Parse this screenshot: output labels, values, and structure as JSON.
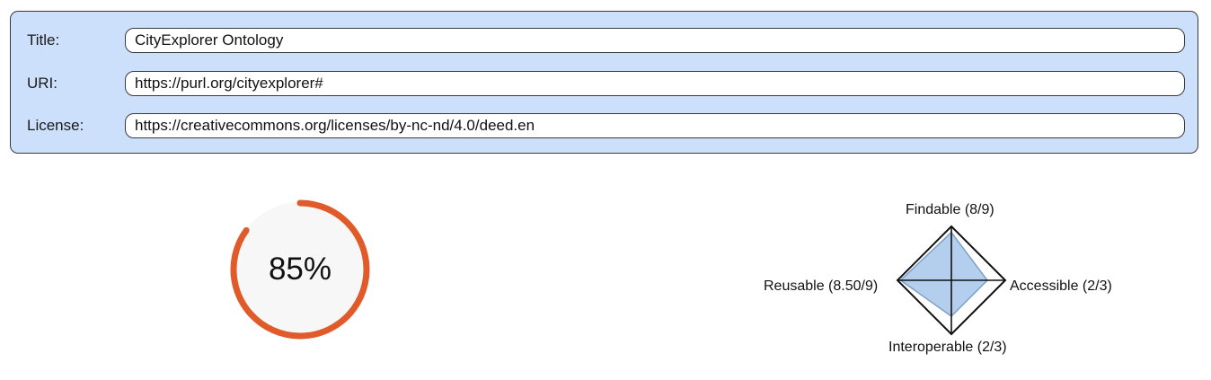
{
  "metadata": {
    "title_label": "Title:",
    "title_value": "CityExplorer Ontology",
    "uri_label": "URI:",
    "uri_value": "https://purl.org/cityexplorer#",
    "license_label": "License:",
    "license_value": "https://creativecommons.org/licenses/by-nc-nd/4.0/deed.en"
  },
  "score": {
    "value": 85,
    "label": "85%",
    "color": "#e05a2a",
    "track_color": "#f7f7f7"
  },
  "radar": {
    "fill_color": "#b4cfee",
    "line_color": "#111111",
    "axes": {
      "findable": {
        "label": "Findable (8/9)",
        "fraction": 0.889
      },
      "accessible": {
        "label": "Accessible (2/3)",
        "fraction": 0.667
      },
      "interoperable": {
        "label": "Interoperable (2/3)",
        "fraction": 0.667
      },
      "reusable": {
        "label": "Reusable (8.50/9)",
        "fraction": 0.944
      }
    }
  }
}
